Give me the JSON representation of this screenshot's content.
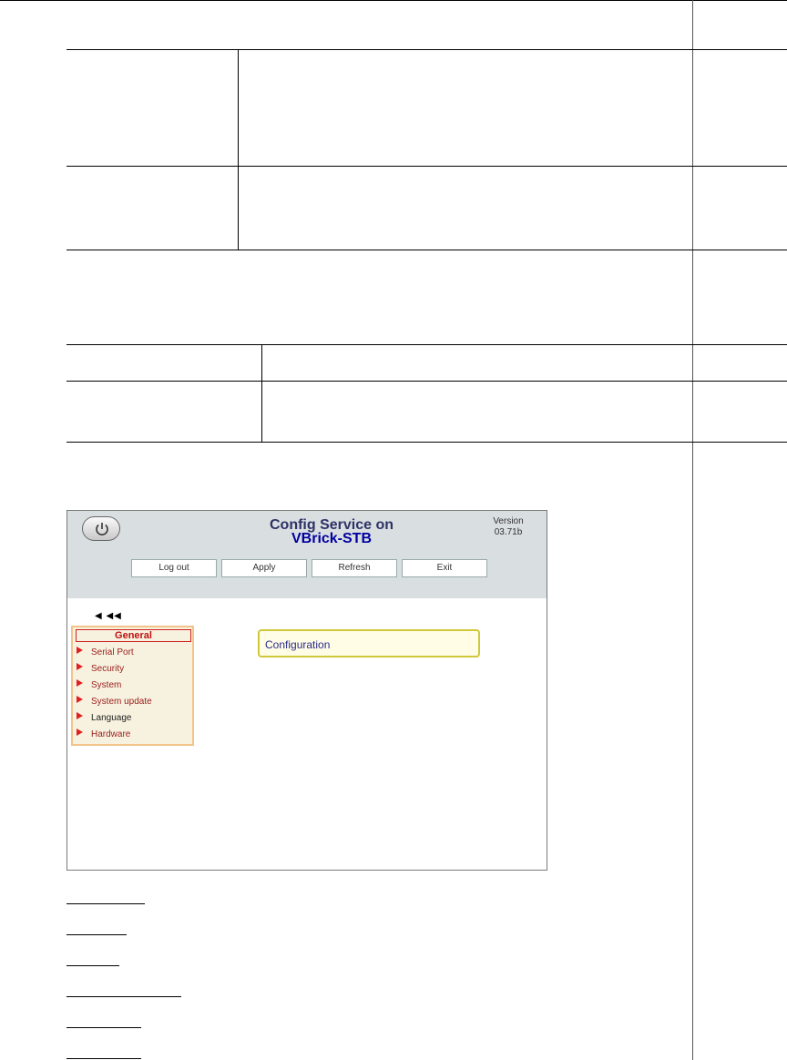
{
  "app": {
    "title_line1": "Config Service on",
    "title_line2": "VBrick-STB",
    "version_label": "Version",
    "version_value": "03.71b"
  },
  "toolbar": {
    "buttons": [
      "Log out",
      "Apply",
      "Refresh",
      "Exit"
    ]
  },
  "nav": {
    "arrows": "◀ ◀◀",
    "header": "General",
    "items": [
      "Serial Port",
      "Security",
      "System",
      "System update",
      "Language",
      "Hardware"
    ]
  },
  "main": {
    "heading": "Configuration"
  },
  "colors": {
    "header_bg": "#d9dee1",
    "menu_bg": "#f7f2df",
    "menu_border": "#f2c48a",
    "accent_red": "#e02020",
    "title_blue": "#0000a0",
    "config_border": "#cfc93a"
  },
  "icons": {
    "power": "power-icon",
    "nav_item": "red-triangle-icon",
    "collapse": "left-arrows-icon"
  }
}
